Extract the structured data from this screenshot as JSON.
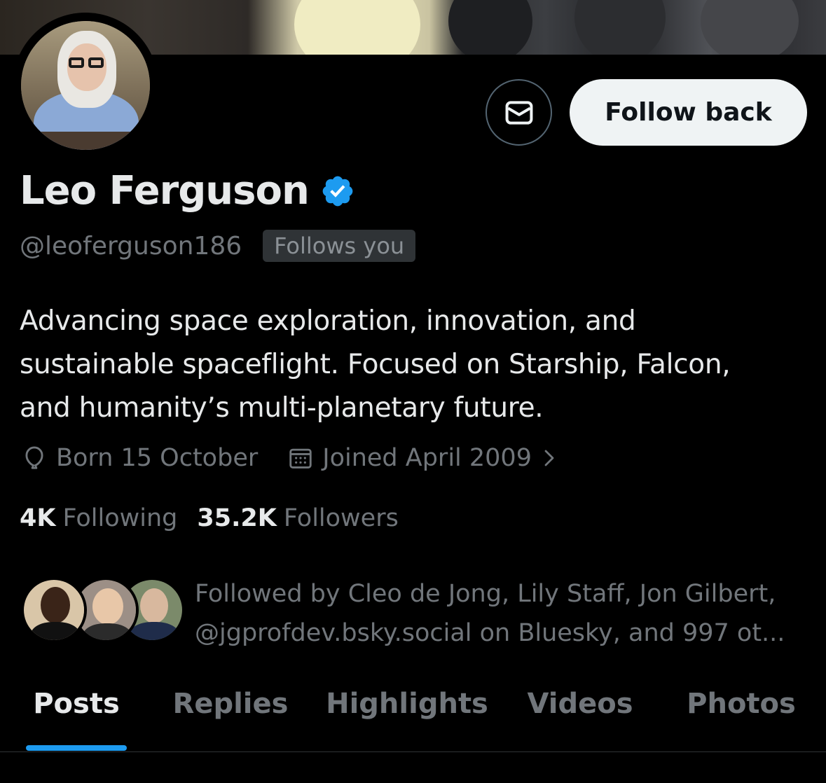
{
  "profile": {
    "display_name": "Leo Ferguson",
    "handle": "@leoferguson186",
    "follows_you_badge": "Follows you",
    "bio_lines": [
      "Advancing space exploration, innovation, and",
      "sustainable spaceflight. Focused on Starship, Falcon,",
      "and humanity’s multi-planetary future."
    ],
    "verified_icon": "verified-badge-icon",
    "verified_color": "#1d9bf0"
  },
  "actions": {
    "message_icon": "envelope-icon",
    "follow_back_label": "Follow back"
  },
  "meta": {
    "born": "Born 15 October",
    "born_icon": "balloon-icon",
    "joined": "Joined April 2009",
    "joined_icon": "calendar-icon",
    "joined_chevron_icon": "chevron-right-icon"
  },
  "stats": {
    "following_count": "4K",
    "following_label": "Following",
    "followers_count": "35.2K",
    "followers_label": "Followers"
  },
  "followed_by": {
    "line1": "Followed by Cleo de Jong, Lily Staff, Jon Gilbert,",
    "line2": "@jgprofdev.bsky.social on Bluesky, and 997 ot..."
  },
  "tabs": [
    {
      "label": "Posts",
      "active": true
    },
    {
      "label": "Replies",
      "active": false
    },
    {
      "label": "Highlights",
      "active": false
    },
    {
      "label": "Videos",
      "active": false
    },
    {
      "label": "Photos",
      "active": false
    }
  ],
  "colors": {
    "background": "#000000",
    "accent": "#1d9bf0",
    "primary_text": "#e7e9ea",
    "secondary_text": "#71767b"
  }
}
